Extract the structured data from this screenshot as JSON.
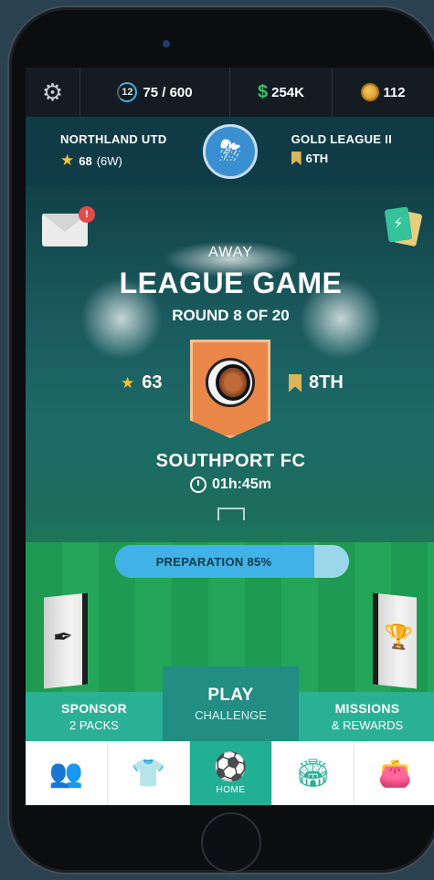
{
  "topbar": {
    "settings_icon": "gear-icon",
    "level": "12",
    "energy": "75 / 600",
    "cash": "254K",
    "coins": "112",
    "cash_color": "#34c46d"
  },
  "club": {
    "name": "NORTHLAND UTD",
    "rating": "68",
    "wins": "(6W)",
    "league": "GOLD LEAGUE II",
    "league_position": "6TH",
    "weather_icon": "storm-cloud-icon"
  },
  "mail": {
    "badge": "!"
  },
  "match": {
    "venue": "AWAY",
    "title": "LEAGUE GAME",
    "round": "ROUND 8 OF 20",
    "opponent_rating": "63",
    "opponent_position": "8TH",
    "opponent_name": "SOUTHPORT FC",
    "countdown": "01h:45m"
  },
  "preparation": {
    "label": "PREPARATION 85%",
    "value": 0.85
  },
  "actions": {
    "sponsor_title": "SPONSOR",
    "sponsor_sub": "2 PACKS",
    "play_title": "PLAY",
    "play_sub": "CHALLENGE",
    "missions_title": "MISSIONS",
    "missions_sub": "& REWARDS"
  },
  "nav": {
    "items": [
      {
        "icon": "people-icon"
      },
      {
        "icon": "shirt-icon"
      },
      {
        "icon": "football-icon",
        "label": "HOME"
      },
      {
        "icon": "stadium-icon"
      },
      {
        "icon": "wallet-icon"
      }
    ]
  },
  "colors": {
    "accent": "#2ab195",
    "play": "#218d83",
    "opponent_badge": "#ea8748"
  }
}
